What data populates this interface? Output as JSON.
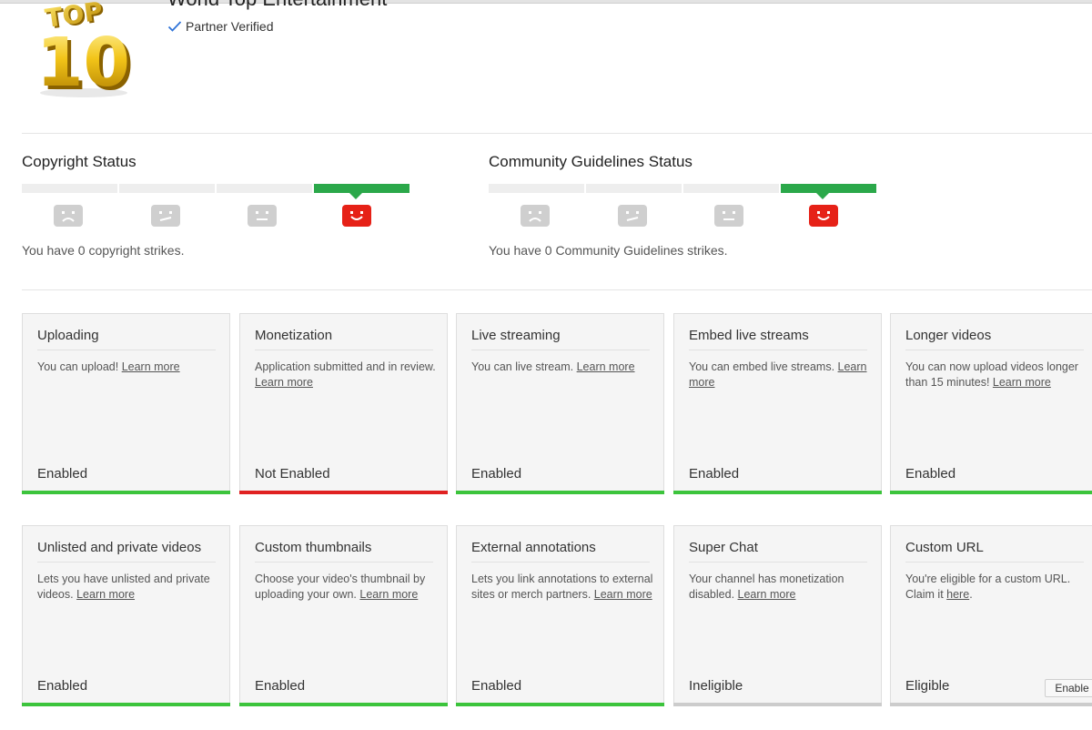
{
  "channel": {
    "name": "World Top Entertainment",
    "verified_label": "Partner Verified",
    "logo_text_top": "TOP",
    "logo_text_num": "10"
  },
  "copyright": {
    "title": "Copyright Status",
    "strikes_text": "You have 0 copyright strikes.",
    "level": 4
  },
  "community": {
    "title": "Community Guidelines Status",
    "strikes_text": "You have 0 Community Guidelines strikes.",
    "level": 4
  },
  "colors": {
    "good_green": "#2ba84a",
    "bar_green": "#3cc43c",
    "bar_red": "#e02222",
    "bar_grey": "#cccccc",
    "face_red": "#e62117",
    "face_grey": "#cfcfcf"
  },
  "cards": [
    {
      "title": "Uploading",
      "desc": "You can upload!",
      "link": "Learn more",
      "desc_after": "",
      "state": "Enabled",
      "bar": "green"
    },
    {
      "title": "Monetization",
      "desc": "Application submitted and in review.",
      "link": "Learn more",
      "desc_after": "",
      "state": "Not Enabled",
      "bar": "red"
    },
    {
      "title": "Live streaming",
      "desc": "You can live stream.",
      "link": "Learn more",
      "desc_after": "",
      "state": "Enabled",
      "bar": "green"
    },
    {
      "title": "Embed live streams",
      "desc": "You can embed live streams.",
      "link": "Learn more",
      "desc_after": "",
      "state": "Enabled",
      "bar": "green"
    },
    {
      "title": "Longer videos",
      "desc": "You can now upload videos longer than 15 minutes!",
      "link": "Learn more",
      "desc_after": "",
      "state": "Enabled",
      "bar": "green"
    },
    {
      "title": "Unlisted and private videos",
      "desc": "Lets you have unlisted and private videos.",
      "link": "Learn more",
      "desc_after": "",
      "state": "Enabled",
      "bar": "green"
    },
    {
      "title": "Custom thumbnails",
      "desc": "Choose your video's thumbnail by uploading your own.",
      "link": "Learn more",
      "desc_after": "",
      "state": "Enabled",
      "bar": "green"
    },
    {
      "title": "External annotations",
      "desc": "Lets you link annotations to external sites or merch partners.",
      "link": "Learn more",
      "desc_after": "",
      "state": "Enabled",
      "bar": "green"
    },
    {
      "title": "Super Chat",
      "desc": "Your channel has monetization disabled.",
      "link": "Learn more",
      "desc_after": "",
      "state": "Ineligible",
      "bar": "grey"
    },
    {
      "title": "Custom URL",
      "desc": "You're eligible for a custom URL. Claim it",
      "link": "here",
      "desc_after": ".",
      "state": "Eligible",
      "bar": "grey",
      "button": "Enable"
    }
  ]
}
